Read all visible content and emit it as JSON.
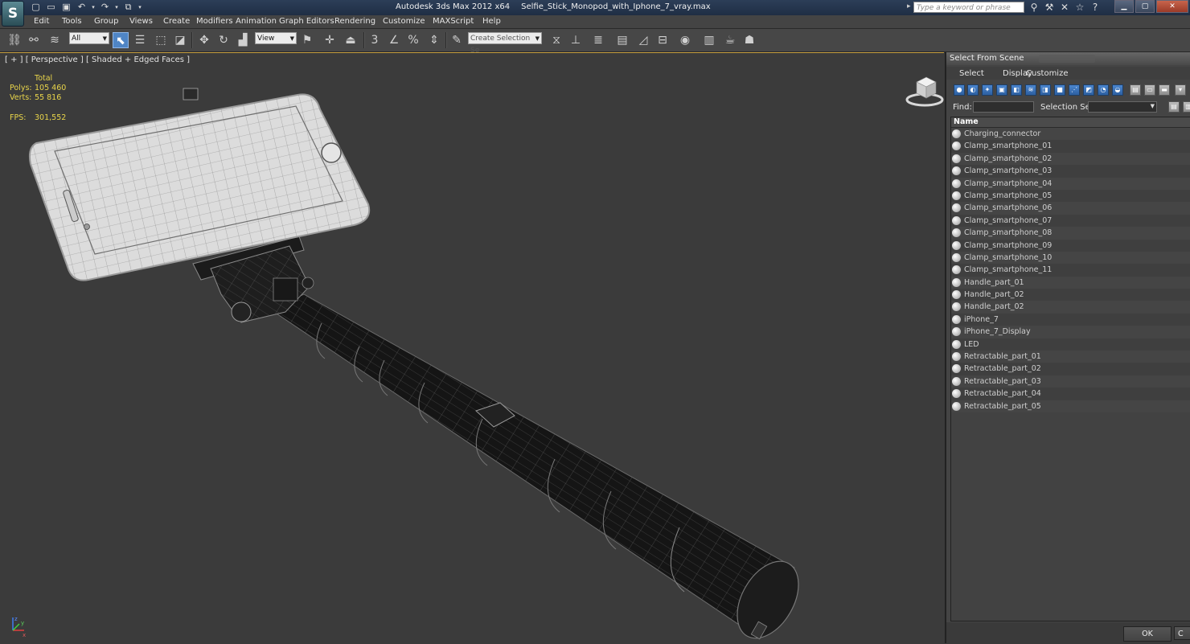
{
  "titlebar": {
    "app_name": "Autodesk 3ds Max  2012 x64",
    "file_name": "Selfie_Stick_Monopod_with_Iphone_7_vray.max",
    "search_placeholder": "Type a keyword or phrase",
    "logo_letter": "S"
  },
  "menu": [
    "Edit",
    "Tools",
    "Group",
    "Views",
    "Create",
    "Modifiers",
    "Animation",
    "Graph Editors",
    "Rendering",
    "Customize",
    "MAXScript",
    "Help"
  ],
  "toolbar": {
    "selection_filter": "All",
    "reference_coord": "View",
    "named_selection": "Create Selection Se",
    "snap_label": "3",
    "percent_snap_label": "%"
  },
  "viewport": {
    "label": "[ + ] [ Perspective ] [ Shaded + Edged Faces ]",
    "stats": {
      "total_label": "Total",
      "polys_label": "Polys:",
      "polys_value": "105 460",
      "verts_label": "Verts:",
      "verts_value": "55 816",
      "fps_label": "FPS:",
      "fps_value": "301,552"
    },
    "axis": {
      "x": "x",
      "y": "y",
      "z": "z"
    }
  },
  "scene_panel": {
    "title": "Select From Scene",
    "menu": [
      "Select",
      "Display",
      "Customize"
    ],
    "find_label": "Find:",
    "selection_set_label": "Selection Set:",
    "column_name": "Name",
    "items": [
      "Charging_connector",
      "Clamp_smartphone_01",
      "Clamp_smartphone_02",
      "Clamp_smartphone_03",
      "Clamp_smartphone_04",
      "Clamp_smartphone_05",
      "Clamp_smartphone_06",
      "Clamp_smartphone_07",
      "Clamp_smartphone_08",
      "Clamp_smartphone_09",
      "Clamp_smartphone_10",
      "Clamp_smartphone_11",
      "Handle_part_01",
      "Handle_part_02",
      "Handle_part_02",
      "iPhone_7",
      "iPhone_7_Display",
      "LED",
      "Retractable_part_01",
      "Retractable_part_02",
      "Retractable_part_03",
      "Retractable_part_04",
      "Retractable_part_05"
    ],
    "ok_label": "OK",
    "cancel_label": "C"
  },
  "colors": {
    "viewport_bg": "#3b3b3b",
    "stats_text": "#e8d44a",
    "active_tool": "#4f85c5",
    "viewport_border": "#c8a040"
  }
}
